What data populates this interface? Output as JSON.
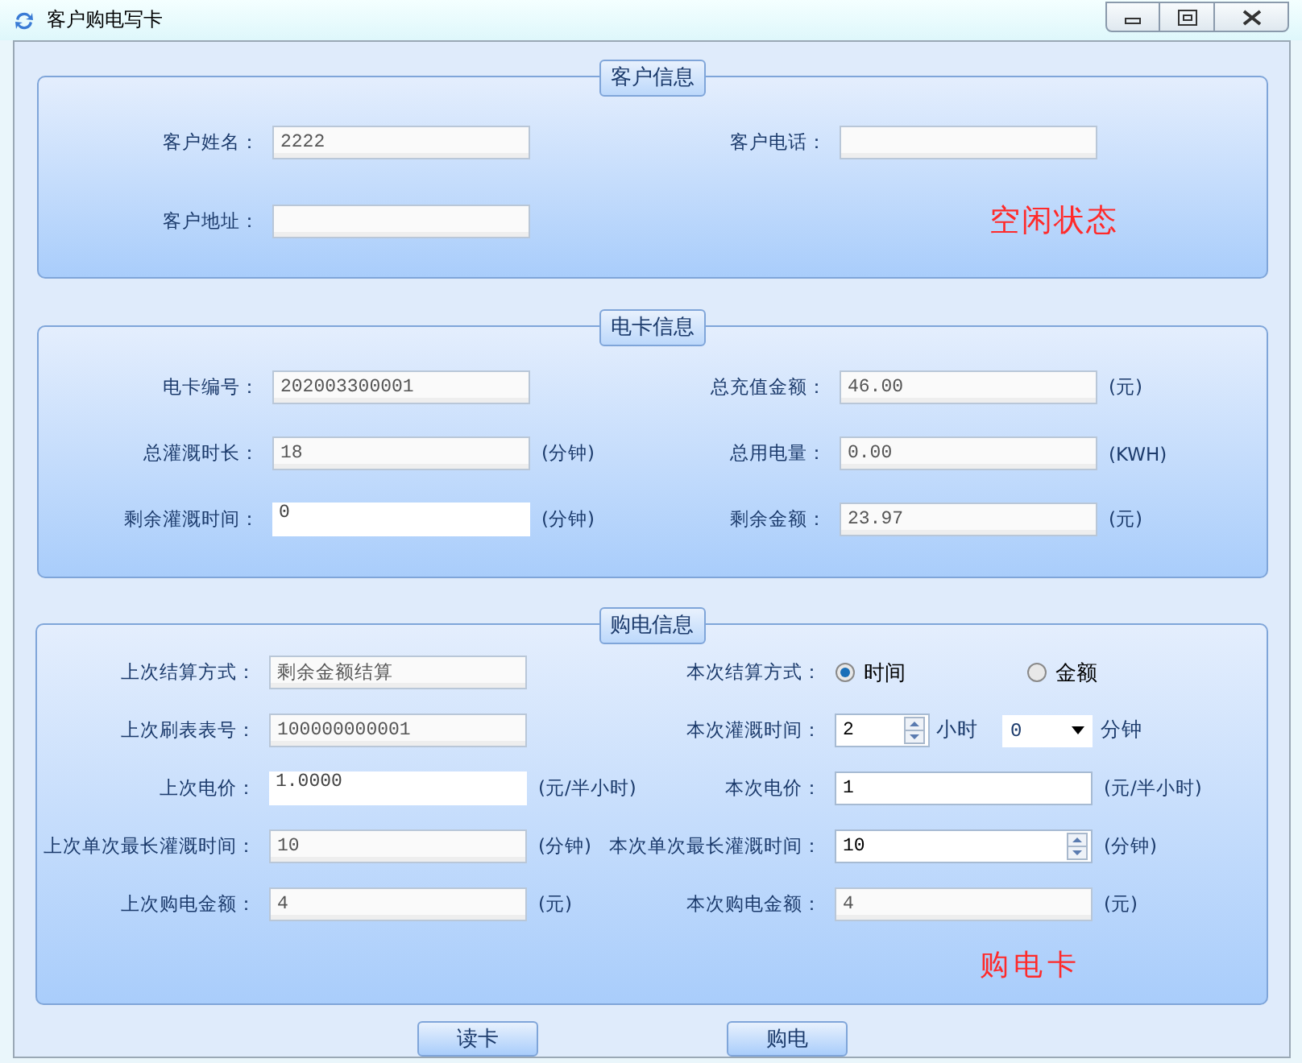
{
  "window": {
    "title": "客户购电写卡"
  },
  "groups": [
    {
      "title": "客户信息",
      "status": "空闲状态",
      "rows": [
        [
          {
            "label": "客户姓名：",
            "kind": "readonly",
            "value": "2222"
          },
          {
            "label": "客户电话：",
            "kind": "readonly"
          }
        ],
        [
          {
            "label": "客户地址：",
            "kind": "readonly"
          }
        ]
      ]
    },
    {
      "title": "电卡信息",
      "rows": [
        [
          {
            "label": "电卡编号：",
            "kind": "readonly",
            "value": "202003300001"
          },
          {
            "label": "总充值金额：",
            "kind": "readonly",
            "value": "46.00",
            "unit": "(元)"
          }
        ],
        [
          {
            "label": "总灌溉时长：",
            "kind": "readonly",
            "value": "18",
            "unit": "(分钟)"
          },
          {
            "label": "总用电量：",
            "kind": "readonly",
            "value": "0.00",
            "unit": "(KWH)"
          }
        ],
        [
          {
            "label": "剩余灌溉时间：",
            "kind": "plain",
            "value": "0",
            "unit": "(分钟)"
          },
          {
            "label": "剩余金额：",
            "kind": "readonly",
            "value": "23.97",
            "unit": "(元)"
          }
        ]
      ]
    },
    {
      "title": "购电信息",
      "status": "购电卡",
      "rows": [
        [
          {
            "label": "上次结算方式：",
            "kind": "readonly",
            "value": "剩余金额结算"
          },
          {
            "label": "本次结算方式：",
            "kind": "radio",
            "options": [
              {
                "label": "时间",
                "selected": true
              },
              {
                "label": "金额",
                "selected": false
              }
            ]
          }
        ],
        [
          {
            "label": "上次刷表表号：",
            "kind": "readonly",
            "value": "100000000001"
          },
          {
            "label": "本次灌溉时间：",
            "kind": "hours",
            "value": "2",
            "hour_unit": "小时",
            "minutes": "0",
            "unit": "分钟"
          }
        ],
        [
          {
            "label": "上次电价：",
            "kind": "plain",
            "value": "1.0000",
            "unit": "(元/半小时)"
          },
          {
            "label": "本次电价：",
            "kind": "input",
            "value": "1",
            "unit": "(元/半小时)"
          }
        ],
        [
          {
            "label": "上次单次最长灌溉时间：",
            "kind": "readonly",
            "value": "10",
            "unit": "(分钟)"
          },
          {
            "label": "本次单次最长灌溉时间：",
            "kind": "spin",
            "value": "10",
            "unit": "(分钟)"
          }
        ],
        [
          {
            "label": "上次购电金额：",
            "kind": "readonly",
            "value": "4",
            "unit": "(元)"
          },
          {
            "label": "本次购电金额：",
            "kind": "readonly",
            "value": "4",
            "unit": "(元)"
          }
        ]
      ]
    }
  ],
  "buttons": [
    "读卡",
    "购电"
  ]
}
